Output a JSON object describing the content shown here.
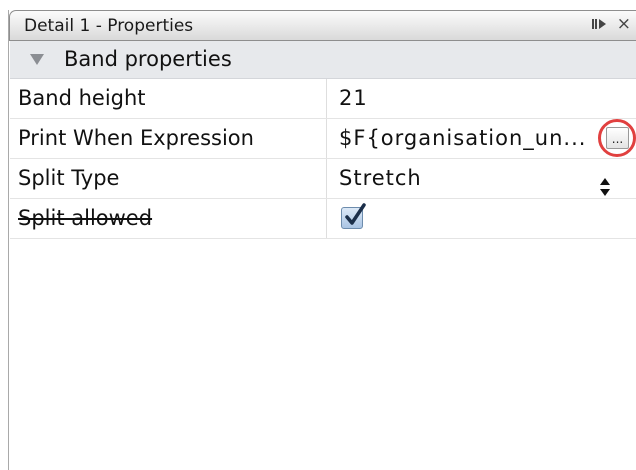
{
  "window": {
    "title": "Detail 1 - Properties"
  },
  "section": {
    "title": "Band properties"
  },
  "properties": [
    {
      "name": "Band height",
      "value": "21"
    },
    {
      "name": "Print When Expression",
      "value": "$F{organisation_un...",
      "button_label": "..."
    },
    {
      "name": "Split Type",
      "value": "Stretch"
    },
    {
      "name": "Split allowed",
      "checked": true
    }
  ],
  "colors": {
    "highlight_ring": "#e1403f",
    "checkbox_fill": "#a9c4e4"
  },
  "icons": {
    "title_controls": [
      "maximize-icon",
      "close-icon"
    ],
    "section_toggle": "expanded-triangle-icon",
    "split_type_control": "spinner-icon",
    "split_allowed_control": "checkmark-icon"
  }
}
